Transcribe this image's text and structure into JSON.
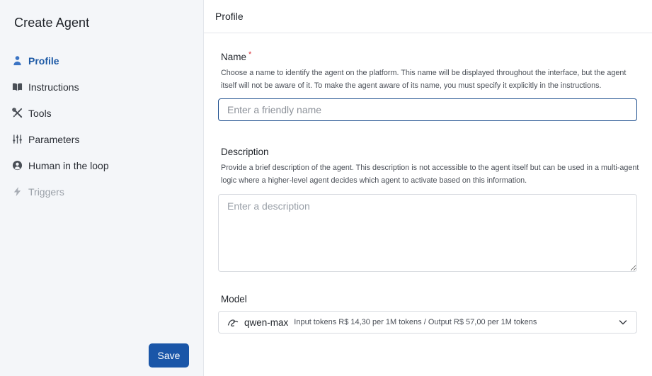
{
  "sidebar": {
    "title": "Create Agent",
    "items": [
      {
        "label": "Profile",
        "icon": "person-icon",
        "active": true
      },
      {
        "label": "Instructions",
        "icon": "book-icon"
      },
      {
        "label": "Tools",
        "icon": "tools-icon"
      },
      {
        "label": "Parameters",
        "icon": "sliders-icon"
      },
      {
        "label": "Human in the loop",
        "icon": "user-circle-icon"
      },
      {
        "label": "Triggers",
        "icon": "bolt-icon",
        "disabled": true
      }
    ],
    "save_label": "Save"
  },
  "header": {
    "title": "Profile"
  },
  "form": {
    "name": {
      "label": "Name",
      "required_mark": "*",
      "help": "Choose a name to identify the agent on the platform. This name will be displayed throughout the interface, but the agent itself will not be aware of it. To make the agent aware of its name, you must specify it explicitly in the instructions.",
      "value": "",
      "placeholder": "Enter a friendly name"
    },
    "description": {
      "label": "Description",
      "help": "Provide a brief description of the agent. This description is not accessible to the agent itself but can be used in a multi-agent logic where a higher-level agent decides which agent to activate based on this information.",
      "value": "",
      "placeholder": "Enter a description"
    },
    "model": {
      "label": "Model",
      "selected_name": "qwen-max",
      "selected_pricing": "Input tokens R$ 14,30 per 1M tokens / Output R$ 57,00 per 1M tokens"
    }
  },
  "colors": {
    "accent": "#1a56a8",
    "active_text": "#1d5aa6",
    "required": "#d9363e"
  }
}
